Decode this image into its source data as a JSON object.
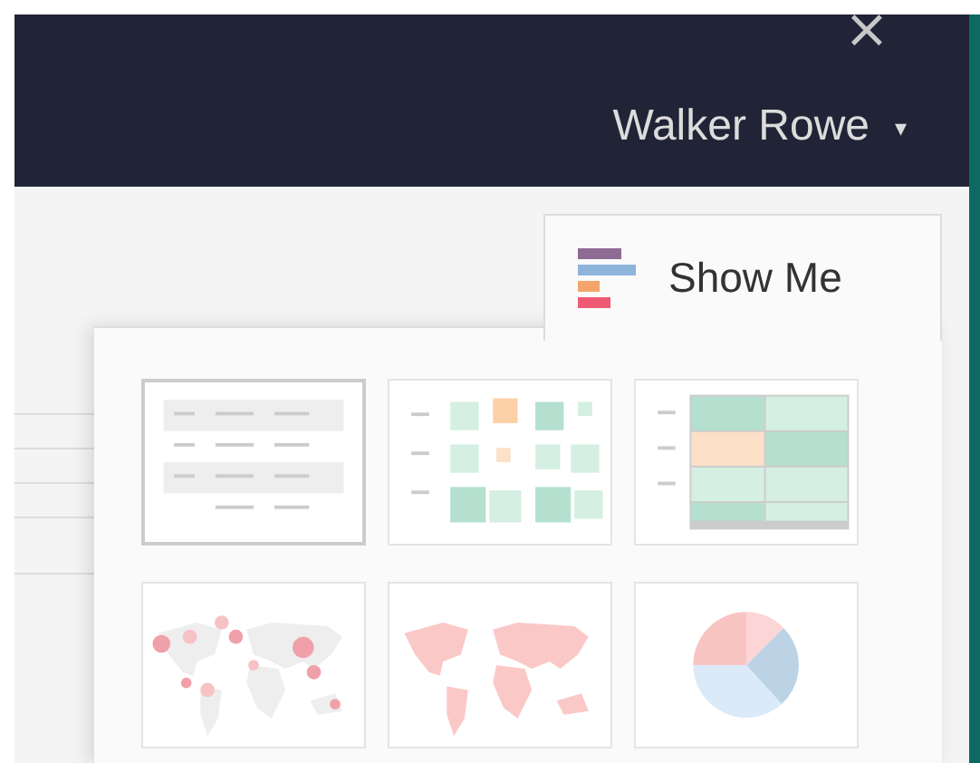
{
  "header": {
    "close": "×",
    "user": "Walker Rowe",
    "user_caret": "▾"
  },
  "show_me": {
    "label": "Show Me",
    "thumbnails": [
      {
        "kind": "text-table",
        "selected": true
      },
      {
        "kind": "heat-map",
        "selected": false
      },
      {
        "kind": "highlight-table",
        "selected": false
      },
      {
        "kind": "symbol-map",
        "selected": false
      },
      {
        "kind": "filled-map",
        "selected": false
      },
      {
        "kind": "pie",
        "selected": false
      }
    ]
  }
}
